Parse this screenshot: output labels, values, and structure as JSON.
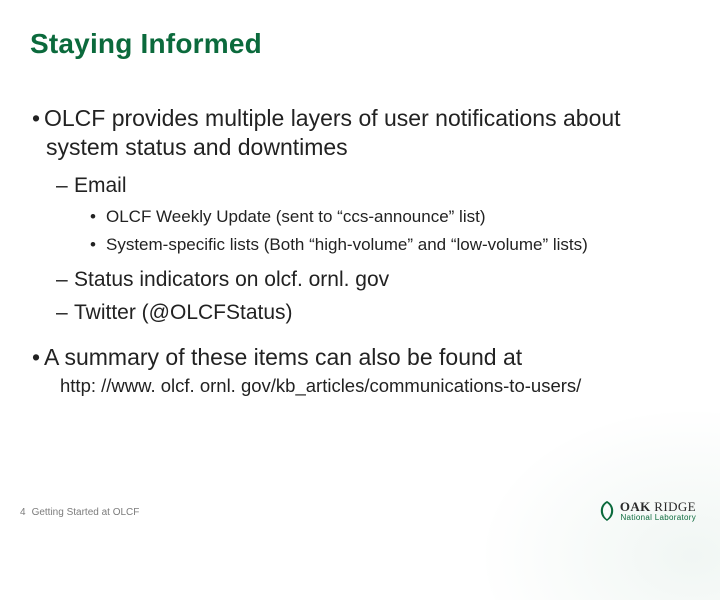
{
  "title": "Staying Informed",
  "bullets": {
    "b1": "OLCF provides multiple layers of user notifications about system status and downtimes",
    "b1_sub1": "Email",
    "b1_sub1_a": "OLCF Weekly Update (sent to “ccs-announce” list)",
    "b1_sub1_b": "System-specific lists (Both “high-volume” and “low-volume” lists)",
    "b1_sub2": "Status indicators on olcf. ornl. gov",
    "b1_sub3": "Twitter (@OLCFStatus)",
    "b2": "A summary of these items can also be found at",
    "b2_url": "http: //www. olcf. ornl. gov/kb_articles/communications-to-users/"
  },
  "footer": {
    "page": "4",
    "label": "Getting Started at OLCF"
  },
  "logo": {
    "line1a": "OAK",
    "line1b": "RIDGE",
    "line2": "National Laboratory"
  }
}
